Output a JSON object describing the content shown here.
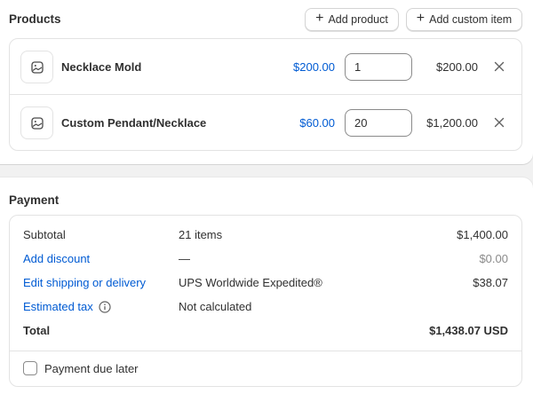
{
  "products": {
    "title": "Products",
    "add_product_label": "Add product",
    "add_custom_label": "Add custom item",
    "items": [
      {
        "name": "Necklace Mold",
        "price": "$200.00",
        "quantity": "1",
        "total": "$200.00"
      },
      {
        "name": "Custom Pendant/Necklace",
        "price": "$60.00",
        "quantity": "20",
        "total": "$1,200.00"
      }
    ]
  },
  "payment": {
    "title": "Payment",
    "lines": [
      {
        "label": "Subtotal",
        "desc": "21 items",
        "amount": "$1,400.00"
      },
      {
        "label": "Add discount",
        "desc": "—",
        "amount": "$0.00"
      },
      {
        "label": "Edit shipping or delivery",
        "desc": "UPS Worldwide Expedited®",
        "amount": "$38.07"
      },
      {
        "label": "Estimated tax",
        "desc": "Not calculated",
        "amount": ""
      },
      {
        "label": "Total",
        "desc": "",
        "amount": "$1,438.07 USD"
      }
    ],
    "due_later_label": "Payment due later"
  },
  "colors": {
    "link": "#005bd3",
    "text": "#303030",
    "muted": "#8a8a8a",
    "border": "#e3e3e3",
    "page_bg": "#f1f1f1"
  },
  "icons": {
    "thumbnail": "image-placeholder-icon",
    "remove": "close-icon",
    "add": "plus-icon",
    "tax_info": "info-icon"
  }
}
